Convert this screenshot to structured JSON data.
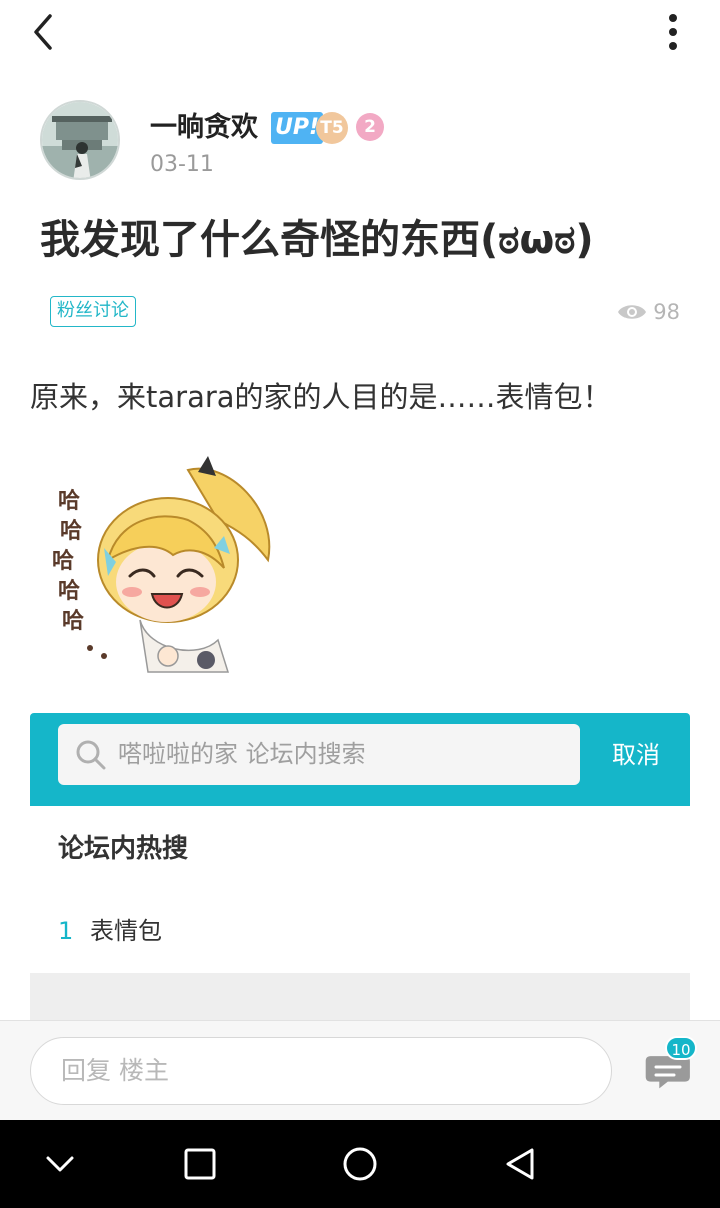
{
  "author": {
    "name": "一晌贪欢",
    "up_badge": "UP!",
    "level_badge": "T5",
    "rank_badge": "2",
    "date": "03-11"
  },
  "post": {
    "title": "我发现了什么奇怪的东西(ಠωಠ)",
    "tag": "粉丝讨论",
    "views": "98",
    "body": "原来，来tarara的家的人目的是……表情包！"
  },
  "sticker": {
    "text": "哈哈哈哈哈…"
  },
  "embedded_screenshot": {
    "search_placeholder": "嗒啦啦的家 论坛内搜索",
    "cancel_label": "取消",
    "hot_title": "论坛内热搜",
    "hot_items": [
      {
        "rank": "1",
        "text": "表情包"
      }
    ]
  },
  "reply_bar": {
    "placeholder": "回复  楼主",
    "comment_count": "10"
  },
  "colors": {
    "accent": "#15b6c9",
    "tag": "#23b7c8",
    "up_badge": "#4fb3f3"
  },
  "icons": {
    "back": "back-arrow-icon",
    "more": "more-vertical-icon",
    "views": "eye-icon",
    "search": "search-icon",
    "comments": "comment-bubble-icon"
  }
}
